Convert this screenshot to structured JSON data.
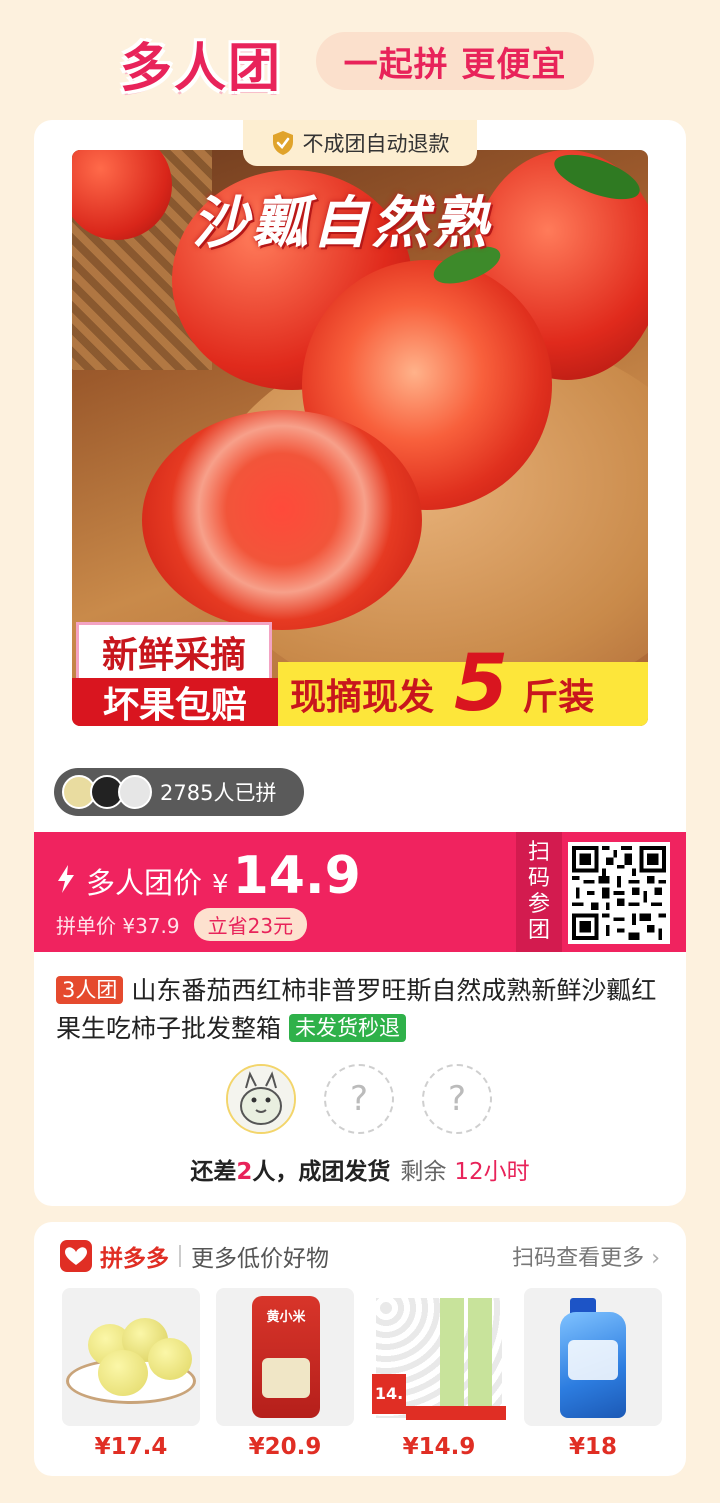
{
  "header": {
    "title": "多人团",
    "slogan": "一起拼 更便宜"
  },
  "product": {
    "refund_tag": "不成团自动退款",
    "image": {
      "banner_text": "沙瓤自然熟",
      "badge_fresh": "新鲜采摘",
      "badge_guarantee": "坏果包赔",
      "badge_ship": "现摘现发",
      "badge_number": "5",
      "badge_unit": "斤装"
    },
    "joined_text": "2785人已拼",
    "group_price_label": "多人团价",
    "currency": "¥",
    "group_price": "14.9",
    "single_price": "拼单价 ¥37.9",
    "save_tag": "立省23元",
    "scan_label": [
      "扫",
      "码",
      "参",
      "团"
    ],
    "group_size_tag": "3人团",
    "title": "山东番茄西红柿非普罗旺斯自然成熟新鲜沙瓤红果生吃柿子批发整箱",
    "refund_green_tag": "未发货秒退",
    "empty_slot_mark": "?",
    "remain": {
      "prefix": "还差",
      "count": "2",
      "suffix": "人，成团发货",
      "left_label": "剩余",
      "time": "12小时"
    }
  },
  "recommend": {
    "brand": "拼多多",
    "subtitle": "更多低价好物",
    "more": "扫码查看更多",
    "items": [
      {
        "name": "lemon-melon",
        "price": "¥17.4"
      },
      {
        "name": "rice-bag",
        "price": "¥20.9",
        "brand_text": "黄小米"
      },
      {
        "name": "tissue-pack",
        "price": "¥14.9",
        "promo": "14."
      },
      {
        "name": "laundry-detergent",
        "price": "¥18"
      }
    ]
  },
  "colors": {
    "accent": "#e8235a",
    "price_bar": "#f0235f",
    "background": "#fdf1de",
    "pdd_red": "#e02e24",
    "green_tag": "#2fb14a"
  }
}
